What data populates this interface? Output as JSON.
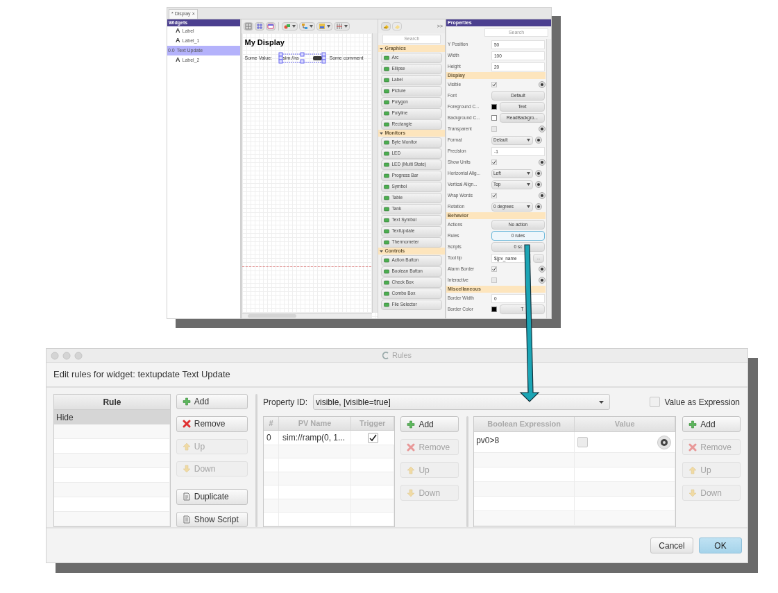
{
  "editor": {
    "tabs": [
      {
        "label": "* Display",
        "close": "×",
        "selected": true
      }
    ],
    "widgets": {
      "title": "Widgets",
      "items": [
        {
          "icon": "A",
          "label": "Label",
          "selected": false
        },
        {
          "icon": "A",
          "label": "Label_1",
          "selected": false
        },
        {
          "icon": "0.0",
          "label": "Text Update",
          "selected": true
        },
        {
          "icon": "A",
          "label": "Label_2",
          "selected": false
        }
      ]
    },
    "canvas": {
      "title": "My Display",
      "label_left": "Some Value:",
      "widget_text": "sim://ra",
      "label_right": "Some comment"
    },
    "palette": {
      "more": ">>",
      "search_placeholder": "Search",
      "groups": [
        {
          "name": "Graphics",
          "expanded": true,
          "items": [
            "Arc",
            "Ellipse",
            "Label",
            "Picture",
            "Polygon",
            "Polyline",
            "Rectangle"
          ]
        },
        {
          "name": "Monitors",
          "expanded": true,
          "items": [
            "Byte Monitor",
            "LED",
            "LED (Multi State)",
            "Progress Bar",
            "Symbol",
            "Table",
            "Tank",
            "Text Symbol",
            "TextUpdate",
            "Thermometer"
          ]
        },
        {
          "name": "Controls",
          "expanded": true,
          "items": [
            "Action Button",
            "Boolean Button",
            "Check Box",
            "Combo Box",
            "File Selector"
          ]
        }
      ]
    },
    "properties": {
      "title": "Properties",
      "search_placeholder": "Search",
      "rows": [
        {
          "kind": "text",
          "label": "Y Position",
          "value": "50"
        },
        {
          "kind": "text",
          "label": "Width",
          "value": "100"
        },
        {
          "kind": "text",
          "label": "Height",
          "value": "20"
        },
        {
          "kind": "section",
          "label": "Display"
        },
        {
          "kind": "check",
          "label": "Visible",
          "checked": true,
          "rule": true
        },
        {
          "kind": "button",
          "label": "Font",
          "value": "Default",
          "focused": false
        },
        {
          "kind": "color",
          "label": "Foreground C...",
          "color": "#000000",
          "value": "Text"
        },
        {
          "kind": "color",
          "label": "Background C...",
          "color": "#ffffff",
          "value": "ReadBackgro..."
        },
        {
          "kind": "check",
          "label": "Transparent",
          "checked": false,
          "rule": true
        },
        {
          "kind": "select",
          "label": "Format",
          "value": "Default",
          "rule": true
        },
        {
          "kind": "text",
          "label": "Precision",
          "value": "-1"
        },
        {
          "kind": "check",
          "label": "Show Units",
          "checked": true,
          "rule": true
        },
        {
          "kind": "select",
          "label": "Horizontal Alig...",
          "value": "Left",
          "rule": true
        },
        {
          "kind": "select",
          "label": "Vertical Align...",
          "value": "Top",
          "rule": true
        },
        {
          "kind": "check",
          "label": "Wrap Words",
          "checked": true,
          "rule": true
        },
        {
          "kind": "select",
          "label": "Rotation",
          "value": "0 degrees",
          "rule": true
        },
        {
          "kind": "section",
          "label": "Behavior"
        },
        {
          "kind": "button",
          "label": "Actions",
          "value": "No action",
          "focused": false
        },
        {
          "kind": "button",
          "label": "Rules",
          "value": "0 rules",
          "focused": true
        },
        {
          "kind": "button",
          "label": "Scripts",
          "value": "0 sc",
          "focused": false
        },
        {
          "kind": "text_more",
          "label": "Tool tip",
          "value": "$(pv_name",
          "more": "..."
        },
        {
          "kind": "check",
          "label": "Alarm Border",
          "checked": true,
          "rule": true
        },
        {
          "kind": "check",
          "label": "Interactive",
          "checked": false,
          "rule": true
        },
        {
          "kind": "section",
          "label": "Miscellaneous"
        },
        {
          "kind": "text",
          "label": "Border Width",
          "value": "0"
        },
        {
          "kind": "color",
          "label": "Border Color",
          "color": "#000000",
          "value": "T"
        }
      ]
    }
  },
  "rules_dialog": {
    "title": "Rules",
    "heading": "Edit rules for widget: textupdate Text Update",
    "rules_table": {
      "column": "Rule",
      "rows": [
        {
          "label": "Hide",
          "selected": true
        }
      ]
    },
    "rule_buttons": [
      {
        "kind": "add",
        "label": "Add",
        "disabled": false
      },
      {
        "kind": "remove",
        "label": "Remove",
        "disabled": false
      },
      {
        "kind": "up",
        "label": "Up",
        "disabled": true
      },
      {
        "kind": "down",
        "label": "Down",
        "disabled": true
      },
      {
        "kind": "duplicate",
        "label": "Duplicate",
        "disabled": false
      },
      {
        "kind": "script",
        "label": "Show Script",
        "disabled": false
      }
    ],
    "property_id": {
      "label": "Property ID:",
      "value": "visible, [visible=true]"
    },
    "value_as_expression": {
      "label": "Value as Expression",
      "checked": false
    },
    "pv_table": {
      "columns": [
        "#",
        "PV Name",
        "Trigger"
      ],
      "rows": [
        {
          "index": "0",
          "name": "sim://ramp(0, 1...",
          "trigger": true
        }
      ]
    },
    "pv_buttons": [
      {
        "kind": "add",
        "label": "Add",
        "disabled": false
      },
      {
        "kind": "remove",
        "label": "Remove",
        "disabled": true
      },
      {
        "kind": "up",
        "label": "Up",
        "disabled": true
      },
      {
        "kind": "down",
        "label": "Down",
        "disabled": true
      }
    ],
    "expression_table": {
      "columns": [
        "Boolean Expression",
        "Value"
      ],
      "rows": [
        {
          "expression": "pv0>8",
          "value": false
        }
      ]
    },
    "expression_buttons": [
      {
        "kind": "add",
        "label": "Add",
        "disabled": false
      },
      {
        "kind": "remove",
        "label": "Remove",
        "disabled": true
      },
      {
        "kind": "up",
        "label": "Up",
        "disabled": true
      },
      {
        "kind": "down",
        "label": "Down",
        "disabled": true
      }
    ],
    "footer_buttons": [
      {
        "label": "Cancel",
        "default": false
      },
      {
        "label": "OK",
        "default": true
      }
    ]
  }
}
